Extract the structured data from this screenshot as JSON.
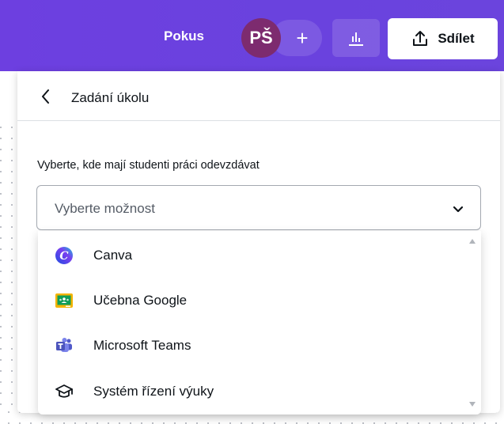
{
  "header": {
    "design_title": "Pokus",
    "avatar_initials": "PŠ",
    "add_people_symbol": "+",
    "share_label": "Sdílet",
    "icons": {
      "add": "plus-icon",
      "insights": "bar-chart-icon",
      "share": "upload-icon"
    },
    "colors": {
      "bar": "#6b42de",
      "avatar": "#7d2b6f"
    }
  },
  "panel": {
    "title": "Zadání úkolu",
    "back_icon": "chevron-left-icon",
    "field_label": "Vyberte, kde mají studenti práci odevzdávat",
    "select": {
      "placeholder": "Vyberte možnost",
      "icon": "chevron-down-icon"
    },
    "options": [
      {
        "label": "Canva",
        "icon": "canva-logo-icon"
      },
      {
        "label": "Učebna Google",
        "icon": "google-classroom-icon"
      },
      {
        "label": "Microsoft Teams",
        "icon": "microsoft-teams-icon"
      },
      {
        "label": "Systém řízení výuky",
        "icon": "graduation-cap-icon"
      }
    ]
  }
}
